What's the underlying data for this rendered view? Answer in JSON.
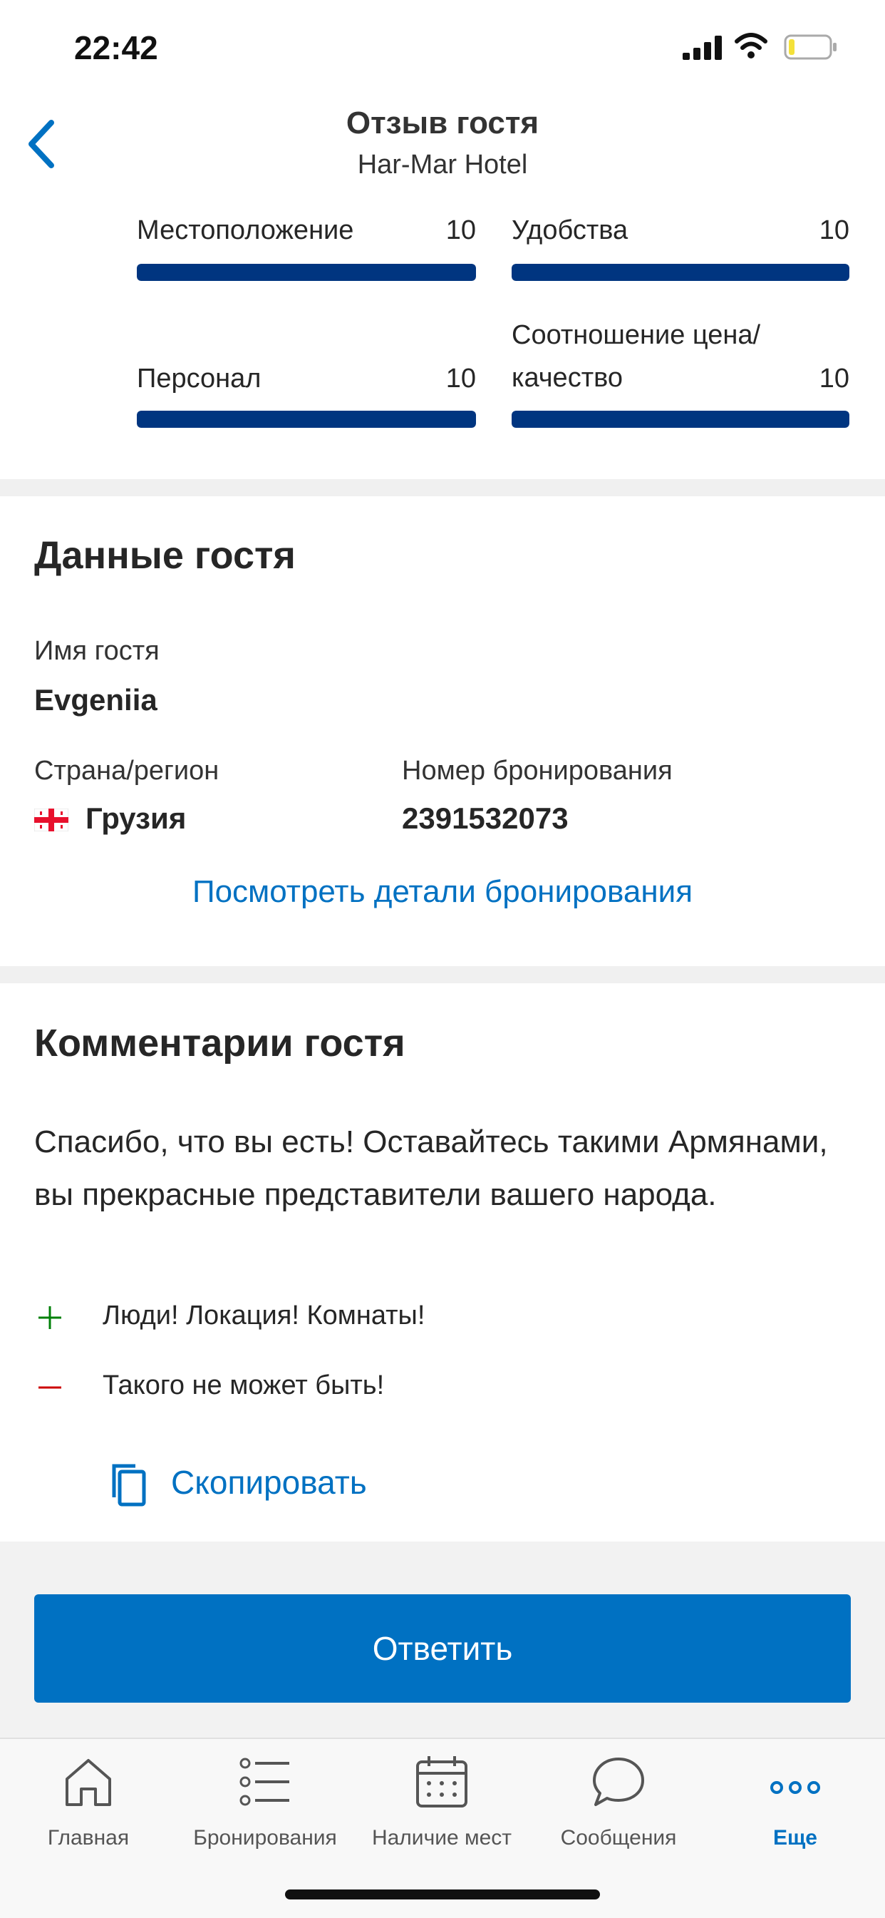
{
  "status_bar": {
    "time": "22:42"
  },
  "header": {
    "title": "Отзыв гостя",
    "subtitle": "Har-Mar Hotel"
  },
  "scores": [
    {
      "label": "Местоположение",
      "value": "10",
      "fill_fraction": 1.0
    },
    {
      "label": "Удобства",
      "value": "10",
      "fill_fraction": 1.0
    },
    {
      "label": "Персонал",
      "value": "10",
      "fill_fraction": 1.0
    },
    {
      "label": "Соотношение цена/ качество",
      "value": "10",
      "fill_fraction": 1.0
    }
  ],
  "guest_section": {
    "title": "Данные гостя",
    "name_label": "Имя гостя",
    "name_value": "Evgeniia",
    "country_label": "Страна/регион",
    "country_value": "Грузия",
    "booking_label": "Номер бронирования",
    "booking_value": "2391532073",
    "details_link": "Посмотреть детали бронирования"
  },
  "comments_section": {
    "title": "Комментарии гостя",
    "text": "Спасибо, что вы есть! Оставайтесь такими Армянами, вы прекрасные представители вашего народа.",
    "positive": "Люди! Локация! Комнаты!",
    "negative": "Такого не может быть!",
    "copy_label": "Скопировать"
  },
  "reply_button": "Ответить",
  "tabbar": [
    {
      "label": "Главная",
      "icon": "home-icon"
    },
    {
      "label": "Бронирования",
      "icon": "list-icon"
    },
    {
      "label": "Наличие мест",
      "icon": "calendar-icon"
    },
    {
      "label": "Сообщения",
      "icon": "chat-bubble-icon"
    },
    {
      "label": "Еще",
      "icon": "more-dots-icon",
      "active": true
    }
  ],
  "colors": {
    "brand_dark_blue": "#003580",
    "action_blue": "#0071c2",
    "positive_green": "#008009",
    "negative_red": "#cc0000"
  }
}
